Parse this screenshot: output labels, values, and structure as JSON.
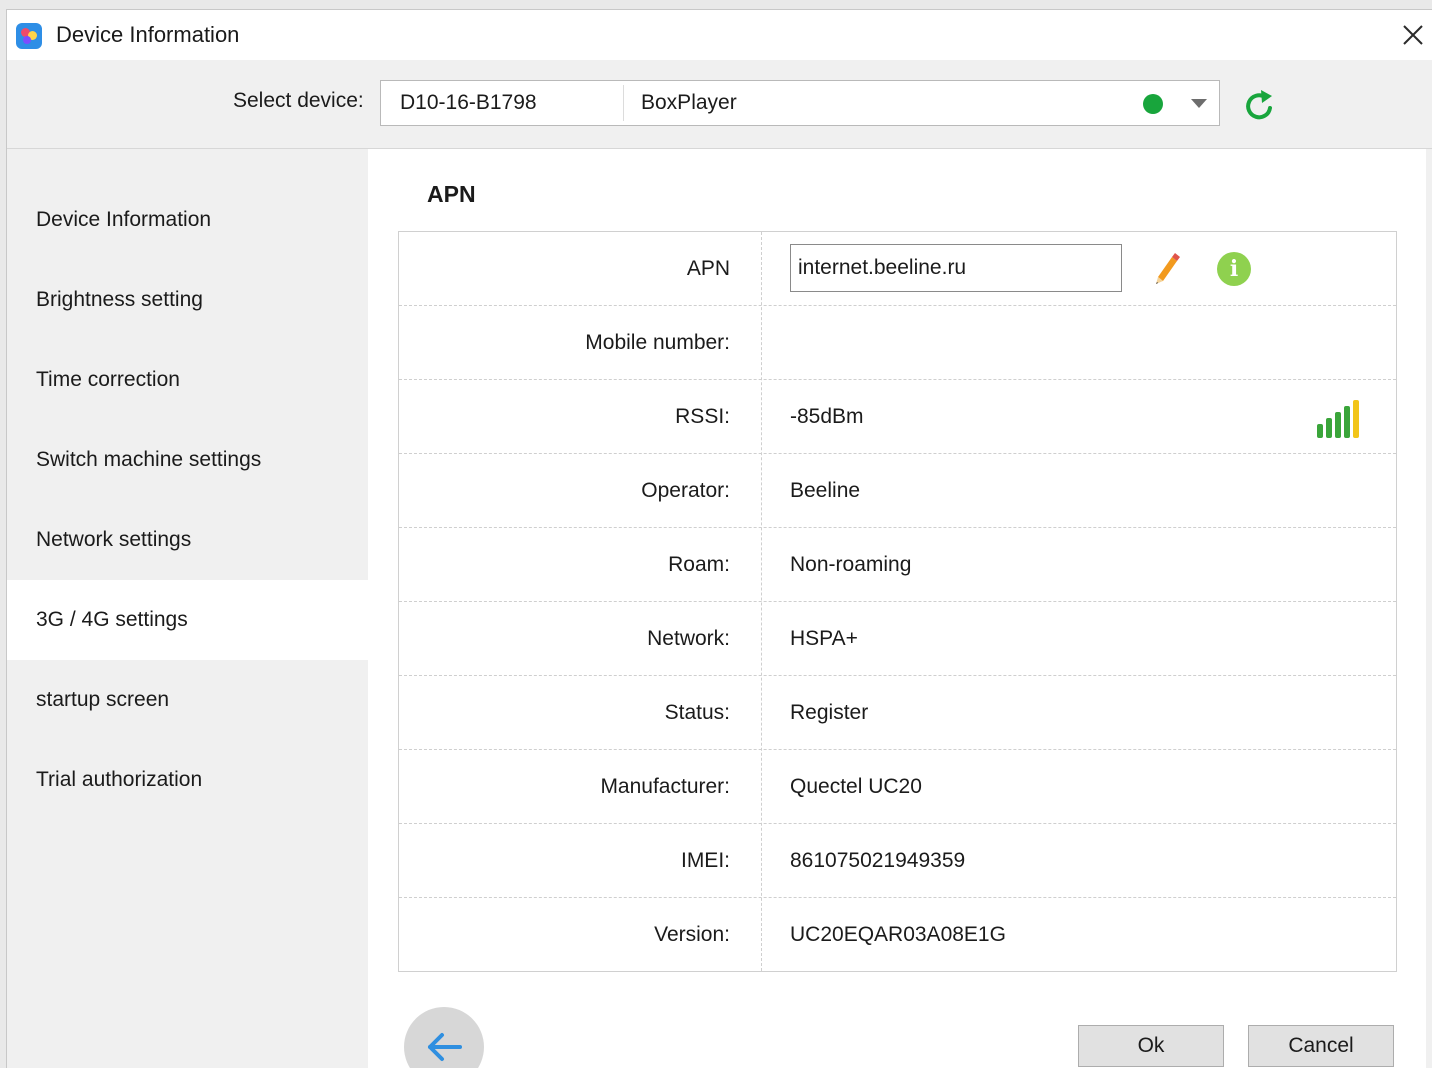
{
  "window": {
    "title": "Device Information",
    "close_glyph": "✕"
  },
  "device_bar": {
    "select_label": "Select device:",
    "device_id": "D10-16-B1798",
    "device_name": "BoxPlayer",
    "status_color": "#18a53c"
  },
  "sidebar": {
    "items": [
      {
        "label": "Device Information"
      },
      {
        "label": "Brightness setting"
      },
      {
        "label": "Time correction"
      },
      {
        "label": "Switch machine settings"
      },
      {
        "label": "Network settings"
      },
      {
        "label": "3G / 4G settings",
        "active": true
      },
      {
        "label": "startup screen"
      },
      {
        "label": "Trial authorization"
      }
    ]
  },
  "content": {
    "title": "APN",
    "apn": {
      "label": "APN",
      "value": "internet.beeline.ru",
      "info_glyph": "i"
    },
    "rows": [
      {
        "label": "Mobile number:",
        "value": ""
      },
      {
        "label": "RSSI:",
        "value": "-85dBm"
      },
      {
        "label": "Operator:",
        "value": "Beeline"
      },
      {
        "label": "Roam:",
        "value": "Non-roaming"
      },
      {
        "label": "Network:",
        "value": "HSPA+"
      },
      {
        "label": "Status:",
        "value": "Register"
      },
      {
        "label": "Manufacturer:",
        "value": "Quectel UC20"
      },
      {
        "label": "IMEI:",
        "value": "861075021949359"
      },
      {
        "label": "Version:",
        "value": "UC20EQAR03A08E1G"
      }
    ],
    "signal_level": 5,
    "signal_max": 5
  },
  "footer": {
    "ok_label": "Ok",
    "cancel_label": "Cancel"
  },
  "colors": {
    "accent_green": "#18a53c",
    "info_green": "#8fd14f",
    "back_arrow": "#2f8fe0"
  }
}
